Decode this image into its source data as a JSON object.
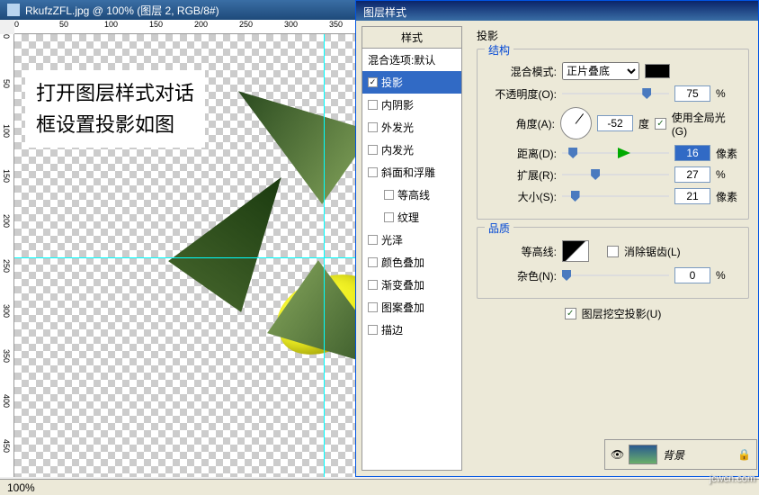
{
  "window": {
    "title": "RkufzZFL.jpg @ 100% (图层 2, RGB/8#)"
  },
  "ruler_h": [
    "0",
    "50",
    "100",
    "150",
    "200",
    "250",
    "300",
    "350"
  ],
  "ruler_v": [
    "0",
    "50",
    "100",
    "150",
    "200",
    "250",
    "300",
    "350",
    "400",
    "450"
  ],
  "note_text": "打开图层样式对话框设置投影如图",
  "dialog": {
    "title": "图层样式",
    "list_header": "样式",
    "blend_default": "混合选项:默认",
    "items": [
      {
        "label": "投影",
        "checked": true,
        "selected": true
      },
      {
        "label": "内阴影",
        "checked": false
      },
      {
        "label": "外发光",
        "checked": false
      },
      {
        "label": "内发光",
        "checked": false
      },
      {
        "label": "斜面和浮雕",
        "checked": false
      },
      {
        "label": "等高线",
        "checked": false,
        "sub": true
      },
      {
        "label": "纹理",
        "checked": false,
        "sub": true
      },
      {
        "label": "光泽",
        "checked": false
      },
      {
        "label": "颜色叠加",
        "checked": false
      },
      {
        "label": "渐变叠加",
        "checked": false
      },
      {
        "label": "图案叠加",
        "checked": false
      },
      {
        "label": "描边",
        "checked": false
      }
    ],
    "panel_title": "投影",
    "structure": {
      "legend": "结构",
      "blend_mode_label": "混合模式:",
      "blend_mode_value": "正片叠底",
      "opacity_label": "不透明度(O):",
      "opacity_value": "75",
      "angle_label": "角度(A):",
      "angle_value": "-52",
      "angle_unit": "度",
      "global_light": "使用全局光(G)",
      "distance_label": "距离(D):",
      "distance_value": "16",
      "spread_label": "扩展(R):",
      "spread_value": "27",
      "size_label": "大小(S):",
      "size_value": "21",
      "px": "像素",
      "pct": "%"
    },
    "quality": {
      "legend": "品质",
      "contour_label": "等高线:",
      "antialias": "消除锯齿(L)",
      "noise_label": "杂色(N):",
      "noise_value": "0"
    },
    "knockout": "图层挖空投影(U)"
  },
  "layers_panel": {
    "bg_label": "背景"
  },
  "status": {
    "zoom": "100%"
  },
  "watermark": "jcwcn.com"
}
